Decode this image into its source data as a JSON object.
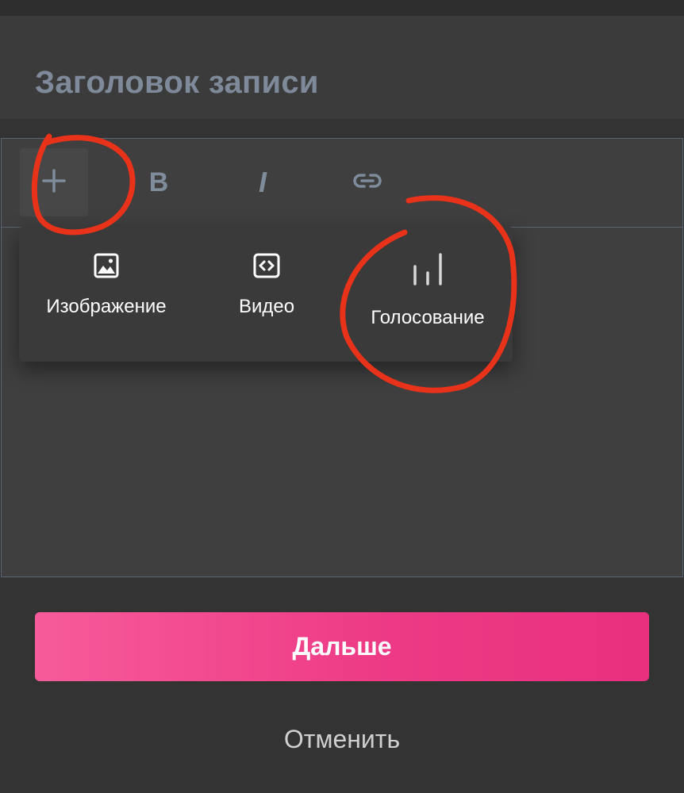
{
  "post": {
    "title_placeholder": "Заголовок записи"
  },
  "toolbar": {
    "items": [
      {
        "icon": "plus-icon"
      },
      {
        "label": "B",
        "icon": "bold-icon"
      },
      {
        "label": "I",
        "icon": "italic-icon"
      },
      {
        "icon": "link-icon"
      }
    ]
  },
  "insert_menu": {
    "items": [
      {
        "label": "Изображение",
        "icon": "image-icon"
      },
      {
        "label": "Видео",
        "icon": "video-embed-icon"
      },
      {
        "label": "Голосование",
        "icon": "poll-icon"
      }
    ]
  },
  "actions": {
    "next_label": "Дальше",
    "cancel_label": "Отменить"
  },
  "colors": {
    "background": "#333333",
    "accent_gradient_start": "#f75b99",
    "accent_gradient_end": "#e8307e",
    "annotation": "#e8321a",
    "muted_text": "#7e8a99"
  }
}
